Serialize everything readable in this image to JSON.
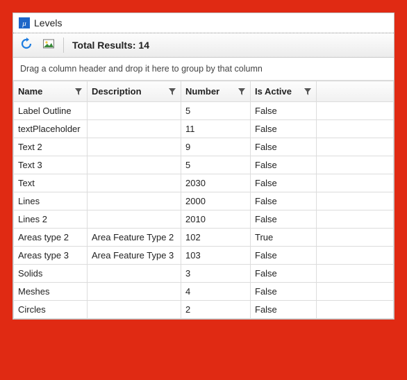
{
  "window": {
    "title": "Levels"
  },
  "toolbar": {
    "total_results_label": "Total Results: 14"
  },
  "group_hint": "Drag a column header and drop it here to group by that column",
  "columns": [
    {
      "label": "Name"
    },
    {
      "label": "Description"
    },
    {
      "label": "Number"
    },
    {
      "label": "Is Active"
    },
    {
      "label": ""
    }
  ],
  "rows": [
    {
      "name": "Label Outline",
      "description": "",
      "number": "5",
      "is_active": "False"
    },
    {
      "name": "textPlaceholder",
      "description": "",
      "number": "11",
      "is_active": "False"
    },
    {
      "name": "Text 2",
      "description": "",
      "number": "9",
      "is_active": "False"
    },
    {
      "name": "Text 3",
      "description": "",
      "number": "5",
      "is_active": "False"
    },
    {
      "name": "Text",
      "description": "",
      "number": "2030",
      "is_active": "False"
    },
    {
      "name": "Lines",
      "description": "",
      "number": "2000",
      "is_active": "False"
    },
    {
      "name": "Lines 2",
      "description": "",
      "number": "2010",
      "is_active": "False"
    },
    {
      "name": "Areas type 2",
      "description": "Area Feature Type 2",
      "number": "102",
      "is_active": "True"
    },
    {
      "name": "Areas type 3",
      "description": "Area Feature Type 3",
      "number": "103",
      "is_active": "False"
    },
    {
      "name": "Solids",
      "description": "",
      "number": "3",
      "is_active": "False"
    },
    {
      "name": "Meshes",
      "description": "",
      "number": "4",
      "is_active": "False"
    },
    {
      "name": "Circles",
      "description": "",
      "number": "2",
      "is_active": "False"
    }
  ]
}
